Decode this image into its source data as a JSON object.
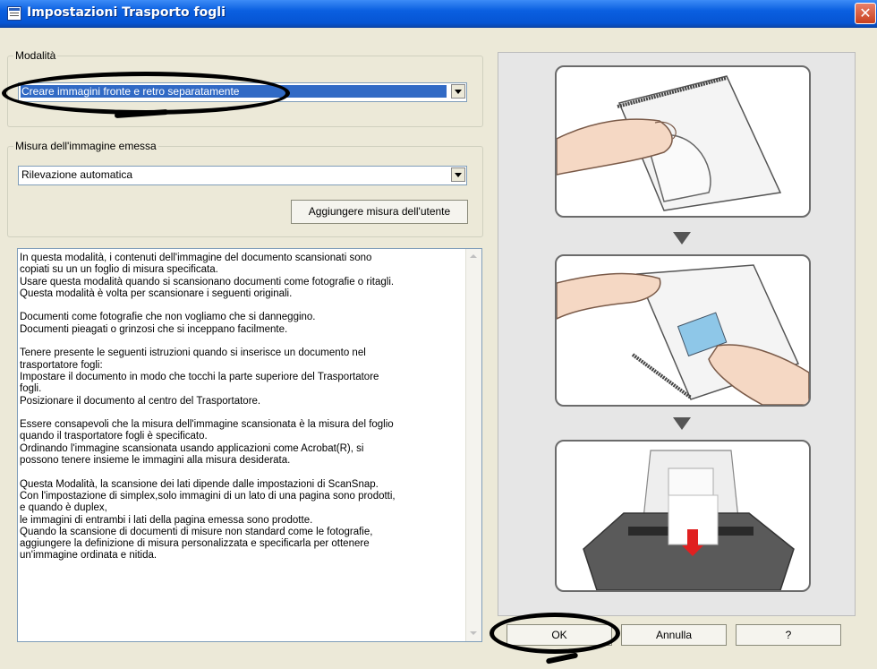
{
  "window": {
    "title": "Impostazioni Trasporto fogli",
    "close_symbol": "✕"
  },
  "mode_group": {
    "legend": "Modalità",
    "selected": "Creare immagini fronte e retro separatamente"
  },
  "size_group": {
    "legend": "Misura dell'immagine emessa",
    "selected": "Rilevazione automatica",
    "add_button": "Aggiungere misura dell'utente"
  },
  "description": {
    "lines": [
      "In questa modalità, i contenuti dell'immagine del documento scansionati sono",
      "copiati su un un foglio di misura specificata.",
      "Usare questa modalità quando si scansionano documenti come fotografie o ritagli.",
      "Questa modalità è volta per scansionare i seguenti originali.",
      "",
      "Documenti come fotografie che non vogliamo che si danneggino.",
      "Documenti pieagati o grinzosi che si inceppano facilmente.",
      "",
      "Tenere presente le seguenti istruzioni quando si inserisce un documento nel",
      "trasportatore fogli:",
      "Impostare il documento in modo che tocchi la parte superiore del Trasportatore",
      "fogli.",
      "Posizionare il documento al centro del Trasportatore.",
      "",
      "Essere consapevoli che la misura dell'immagine scansionata è la misura del foglio",
      "quando il trasportatore fogli è specificato.",
      "Ordinando l'immagine scansionata usando applicazioni come  Acrobat(R), si",
      "possono tenere insieme le immagini alla misura desiderata.",
      "",
      "Questa Modalità, la scansione dei lati dipende dalle impostazioni di ScanSnap.",
      "Con l'impostazione di simplex,solo immagini di un lato di una pagina sono prodotti,",
      "e quando è duplex,",
      "le immagini di entrambi i lati della pagina emessa sono prodotte.",
      "Quando la scansione di documenti di misure non standard come le fotografie,",
      "aggiungere la definizione di misura personalizzata e specificarla per ottenere",
      "un'immagine ordinata e nitida."
    ]
  },
  "buttons": {
    "ok": "OK",
    "cancel": "Annulla",
    "help": "?"
  }
}
